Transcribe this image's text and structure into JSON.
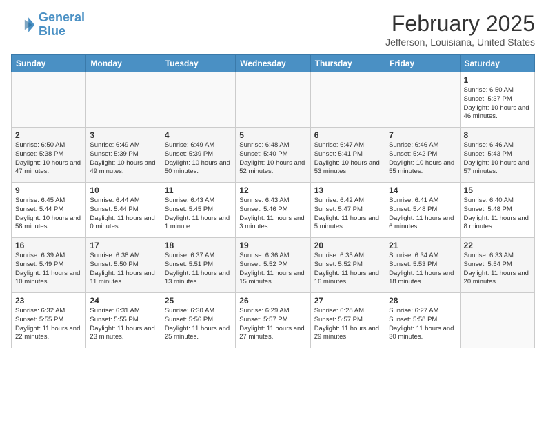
{
  "header": {
    "logo_line1": "General",
    "logo_line2": "Blue",
    "month": "February 2025",
    "location": "Jefferson, Louisiana, United States"
  },
  "weekdays": [
    "Sunday",
    "Monday",
    "Tuesday",
    "Wednesday",
    "Thursday",
    "Friday",
    "Saturday"
  ],
  "weeks": [
    [
      {
        "day": "",
        "info": ""
      },
      {
        "day": "",
        "info": ""
      },
      {
        "day": "",
        "info": ""
      },
      {
        "day": "",
        "info": ""
      },
      {
        "day": "",
        "info": ""
      },
      {
        "day": "",
        "info": ""
      },
      {
        "day": "1",
        "info": "Sunrise: 6:50 AM\nSunset: 5:37 PM\nDaylight: 10 hours and 46 minutes."
      }
    ],
    [
      {
        "day": "2",
        "info": "Sunrise: 6:50 AM\nSunset: 5:38 PM\nDaylight: 10 hours and 47 minutes."
      },
      {
        "day": "3",
        "info": "Sunrise: 6:49 AM\nSunset: 5:39 PM\nDaylight: 10 hours and 49 minutes."
      },
      {
        "day": "4",
        "info": "Sunrise: 6:49 AM\nSunset: 5:39 PM\nDaylight: 10 hours and 50 minutes."
      },
      {
        "day": "5",
        "info": "Sunrise: 6:48 AM\nSunset: 5:40 PM\nDaylight: 10 hours and 52 minutes."
      },
      {
        "day": "6",
        "info": "Sunrise: 6:47 AM\nSunset: 5:41 PM\nDaylight: 10 hours and 53 minutes."
      },
      {
        "day": "7",
        "info": "Sunrise: 6:46 AM\nSunset: 5:42 PM\nDaylight: 10 hours and 55 minutes."
      },
      {
        "day": "8",
        "info": "Sunrise: 6:46 AM\nSunset: 5:43 PM\nDaylight: 10 hours and 57 minutes."
      }
    ],
    [
      {
        "day": "9",
        "info": "Sunrise: 6:45 AM\nSunset: 5:44 PM\nDaylight: 10 hours and 58 minutes."
      },
      {
        "day": "10",
        "info": "Sunrise: 6:44 AM\nSunset: 5:44 PM\nDaylight: 11 hours and 0 minutes."
      },
      {
        "day": "11",
        "info": "Sunrise: 6:43 AM\nSunset: 5:45 PM\nDaylight: 11 hours and 1 minute."
      },
      {
        "day": "12",
        "info": "Sunrise: 6:43 AM\nSunset: 5:46 PM\nDaylight: 11 hours and 3 minutes."
      },
      {
        "day": "13",
        "info": "Sunrise: 6:42 AM\nSunset: 5:47 PM\nDaylight: 11 hours and 5 minutes."
      },
      {
        "day": "14",
        "info": "Sunrise: 6:41 AM\nSunset: 5:48 PM\nDaylight: 11 hours and 6 minutes."
      },
      {
        "day": "15",
        "info": "Sunrise: 6:40 AM\nSunset: 5:48 PM\nDaylight: 11 hours and 8 minutes."
      }
    ],
    [
      {
        "day": "16",
        "info": "Sunrise: 6:39 AM\nSunset: 5:49 PM\nDaylight: 11 hours and 10 minutes."
      },
      {
        "day": "17",
        "info": "Sunrise: 6:38 AM\nSunset: 5:50 PM\nDaylight: 11 hours and 11 minutes."
      },
      {
        "day": "18",
        "info": "Sunrise: 6:37 AM\nSunset: 5:51 PM\nDaylight: 11 hours and 13 minutes."
      },
      {
        "day": "19",
        "info": "Sunrise: 6:36 AM\nSunset: 5:52 PM\nDaylight: 11 hours and 15 minutes."
      },
      {
        "day": "20",
        "info": "Sunrise: 6:35 AM\nSunset: 5:52 PM\nDaylight: 11 hours and 16 minutes."
      },
      {
        "day": "21",
        "info": "Sunrise: 6:34 AM\nSunset: 5:53 PM\nDaylight: 11 hours and 18 minutes."
      },
      {
        "day": "22",
        "info": "Sunrise: 6:33 AM\nSunset: 5:54 PM\nDaylight: 11 hours and 20 minutes."
      }
    ],
    [
      {
        "day": "23",
        "info": "Sunrise: 6:32 AM\nSunset: 5:55 PM\nDaylight: 11 hours and 22 minutes."
      },
      {
        "day": "24",
        "info": "Sunrise: 6:31 AM\nSunset: 5:55 PM\nDaylight: 11 hours and 23 minutes."
      },
      {
        "day": "25",
        "info": "Sunrise: 6:30 AM\nSunset: 5:56 PM\nDaylight: 11 hours and 25 minutes."
      },
      {
        "day": "26",
        "info": "Sunrise: 6:29 AM\nSunset: 5:57 PM\nDaylight: 11 hours and 27 minutes."
      },
      {
        "day": "27",
        "info": "Sunrise: 6:28 AM\nSunset: 5:57 PM\nDaylight: 11 hours and 29 minutes."
      },
      {
        "day": "28",
        "info": "Sunrise: 6:27 AM\nSunset: 5:58 PM\nDaylight: 11 hours and 30 minutes."
      },
      {
        "day": "",
        "info": ""
      }
    ]
  ]
}
